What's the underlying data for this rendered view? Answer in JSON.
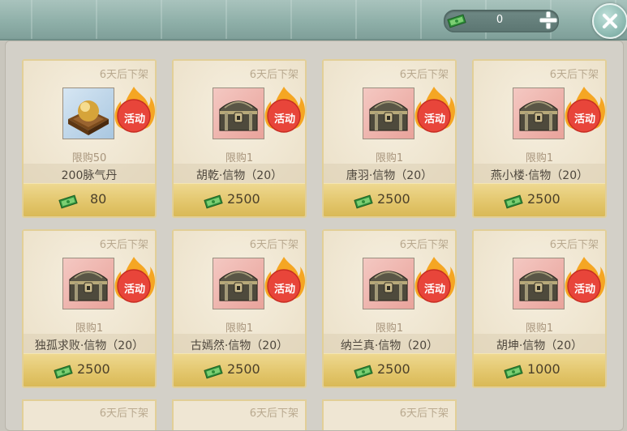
{
  "currency": {
    "amount": "0",
    "icon": "cash-icon"
  },
  "items": [
    {
      "timer": "6天后下架",
      "limit": "限购50",
      "name": "200脉气丹",
      "price": "80",
      "badge": "活动",
      "icon": "golden-orb-icon"
    },
    {
      "timer": "6天后下架",
      "limit": "限购1",
      "name": "胡乾·信物（20）",
      "price": "2500",
      "badge": "活动",
      "icon": "treasure-chest-icon"
    },
    {
      "timer": "6天后下架",
      "limit": "限购1",
      "name": "唐羽·信物（20）",
      "price": "2500",
      "badge": "活动",
      "icon": "treasure-chest-icon"
    },
    {
      "timer": "6天后下架",
      "limit": "限购1",
      "name": "燕小楼·信物（20）",
      "price": "2500",
      "badge": "活动",
      "icon": "treasure-chest-icon"
    },
    {
      "timer": "6天后下架",
      "limit": "限购1",
      "name": "独孤求败·信物（20）",
      "price": "2500",
      "badge": "活动",
      "icon": "treasure-chest-icon"
    },
    {
      "timer": "6天后下架",
      "limit": "限购1",
      "name": "古嫣然·信物（20）",
      "price": "2500",
      "badge": "活动",
      "icon": "treasure-chest-icon"
    },
    {
      "timer": "6天后下架",
      "limit": "限购1",
      "name": "纳兰真·信物（20）",
      "price": "2500",
      "badge": "活动",
      "icon": "treasure-chest-icon"
    },
    {
      "timer": "6天后下架",
      "limit": "限购1",
      "name": "胡坤·信物（20）",
      "price": "1000",
      "badge": "活动",
      "icon": "treasure-chest-icon"
    }
  ],
  "partial_items": [
    {
      "timer": "6天后下架"
    },
    {
      "timer": "6天后下架"
    },
    {
      "timer": "6天后下架"
    }
  ],
  "colors": {
    "badge_fill": "#e8453a",
    "flame": "#f5a623",
    "price_bar": "#e2c56a"
  }
}
